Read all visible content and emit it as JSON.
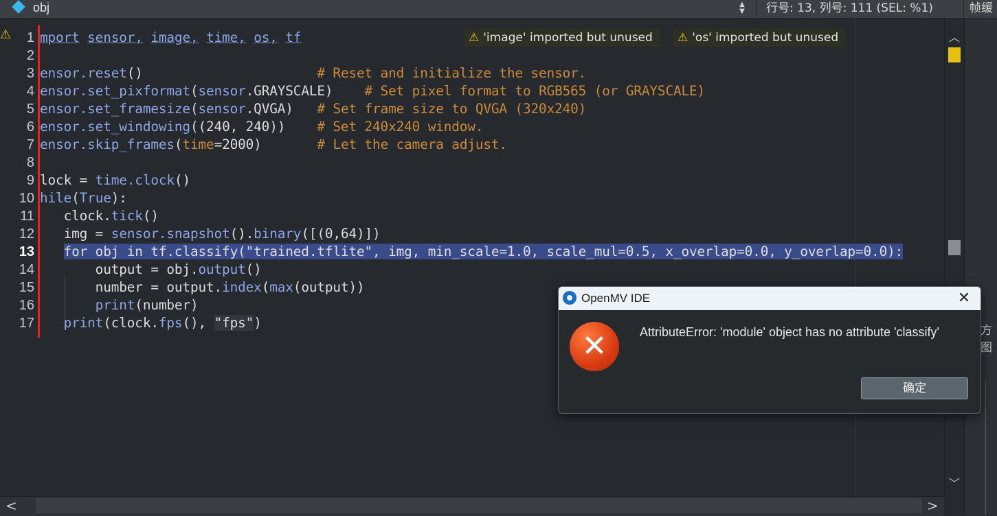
{
  "tab": {
    "file_name": "obj",
    "status": "行号: 13, 列号: 111  (SEL: %1)",
    "frame_label": "帧缓"
  },
  "right_panel": {
    "partial_text": "方图"
  },
  "editor": {
    "current_line": 13,
    "warnings": [
      "'image' imported but unused",
      "'os' imported but unused"
    ],
    "lines": [
      {
        "n": "1",
        "text": "mport sensor, image, time, os, tf"
      },
      {
        "n": "2",
        "text": ""
      },
      {
        "n": "3",
        "text": "ensor.reset()                      # Reset and initialize the sensor."
      },
      {
        "n": "4",
        "text": "ensor.set_pixformat(sensor.GRAYSCALE)    # Set pixel format to RGB565 (or GRAYSCALE)"
      },
      {
        "n": "5",
        "text": "ensor.set_framesize(sensor.QVGA)   # Set frame size to QVGA (320x240)"
      },
      {
        "n": "6",
        "text": "ensor.set_windowing((240, 240))    # Set 240x240 window."
      },
      {
        "n": "7",
        "text": "ensor.skip_frames(time=2000)       # Let the camera adjust."
      },
      {
        "n": "8",
        "text": ""
      },
      {
        "n": "9",
        "text": "lock = time.clock()"
      },
      {
        "n": "10",
        "text": "hile(True):"
      },
      {
        "n": "11",
        "text": "   clock.tick()"
      },
      {
        "n": "12",
        "text": "   img = sensor.snapshot().binary([(0,64)])"
      },
      {
        "n": "13",
        "text": "   for obj in tf.classify(\"trained.tflite\", img, min_scale=1.0, scale_mul=0.5, x_overlap=0.0, y_overlap=0.0):"
      },
      {
        "n": "14",
        "text": "       output = obj.output()"
      },
      {
        "n": "15",
        "text": "       number = output.index(max(output))"
      },
      {
        "n": "16",
        "text": "       print(number)"
      },
      {
        "n": "17",
        "text": "   print(clock.fps(), \"fps\")"
      }
    ]
  },
  "dialog": {
    "title": "OpenMV IDE",
    "message": "AttributeError: 'module' object has no attribute 'classify'",
    "ok_label": "确定",
    "colors": {
      "error": "#d93b12",
      "title_bg": "#eef3f8"
    }
  },
  "colors": {
    "editor_bg": "#262a2e",
    "selection": "#3a4b8c",
    "keyword": "#8ca6e6",
    "comment": "#cc8a38",
    "warning": "#f0c419",
    "error_bar": "#e0261e"
  }
}
